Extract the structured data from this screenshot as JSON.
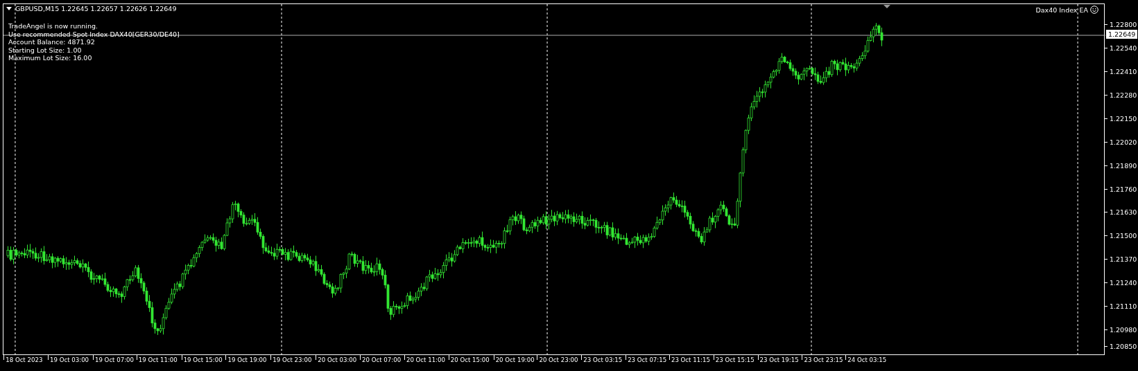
{
  "chart": {
    "symbol_header": "GBPUSD,M15  1.22645 1.22657 1.22626 1.22649",
    "messages": [
      "TradeAngel is now running.",
      "Use recommended Spot Index DAX40[GER30/DE40]",
      "Account Balance: 4871.92",
      "Starting Lot Size: 1.00",
      "Maximum Lot Size: 16.00"
    ],
    "expert_label": "Dax40 Index EA",
    "current_price": "1.22649",
    "price_ticks": [
      "1.22800",
      "1.22540",
      "1.22410",
      "1.22280",
      "1.22150",
      "1.22020",
      "1.21890",
      "1.21760",
      "1.21630",
      "1.21500",
      "1.21370",
      "1.21240",
      "1.21110",
      "1.20980",
      "1.20850"
    ],
    "time_labels": [
      "18 Oct 2023",
      "19 Oct 03:00",
      "19 Oct 07:00",
      "19 Oct 11:00",
      "19 Oct 15:00",
      "19 Oct 19:00",
      "19 Oct 23:00",
      "20 Oct 03:00",
      "20 Oct 07:00",
      "20 Oct 11:00",
      "20 Oct 15:00",
      "20 Oct 19:00",
      "20 Oct 23:00",
      "23 Oct 03:15",
      "23 Oct 07:15",
      "23 Oct 11:15",
      "23 Oct 15:15",
      "23 Oct 19:15",
      "23 Oct 23:15",
      "24 Oct 03:15"
    ]
  }
}
